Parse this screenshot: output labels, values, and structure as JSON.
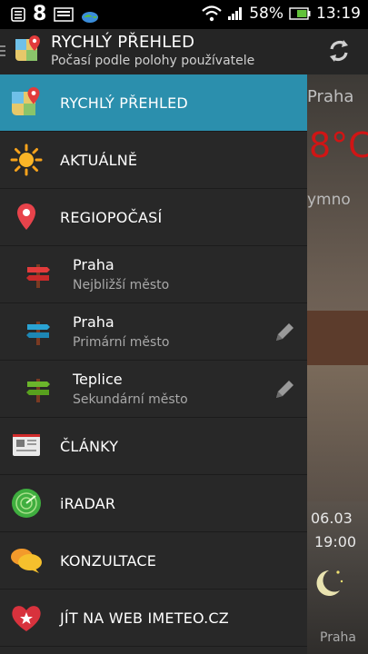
{
  "status_bar": {
    "notification_count": "8",
    "battery": "58%",
    "time": "13:19"
  },
  "action_bar": {
    "title": "RYCHLÝ PŘEHLED",
    "subtitle": "Počasí podle polohy používatele"
  },
  "background": {
    "city": "Praha",
    "temperature": "8°C",
    "description": "ymno",
    "date": "06.03",
    "time": "19:00",
    "footer": "Praha"
  },
  "drawer": {
    "items": [
      {
        "label": "RYCHLÝ PŘEHLED",
        "icon": "map-pin-icon",
        "active": true
      },
      {
        "label": "AKTUÁLNĚ",
        "icon": "sun-icon"
      },
      {
        "label": "REGIOPOČASÍ",
        "icon": "location-pin-icon"
      }
    ],
    "places": [
      {
        "name": "Praha",
        "desc": "Nejbližší město",
        "color": "#e23b3b",
        "editable": false
      },
      {
        "name": "Praha",
        "desc": "Primární město",
        "color": "#2aa3d4",
        "editable": true
      },
      {
        "name": "Teplice",
        "desc": "Sekundární město",
        "color": "#6bb52b",
        "editable": true
      }
    ],
    "bottom_items": [
      {
        "label": "ČLÁNKY",
        "icon": "newspaper-icon"
      },
      {
        "label": "iRADAR",
        "icon": "radar-icon"
      },
      {
        "label": "KONZULTACE",
        "icon": "chat-bubbles-icon"
      },
      {
        "label": "JÍT NA WEB IMETEO.CZ",
        "icon": "heart-star-icon"
      }
    ]
  },
  "colors": {
    "active_row": "#2b8fad",
    "drawer_bg": "#282828",
    "temperature": "#d01515"
  }
}
